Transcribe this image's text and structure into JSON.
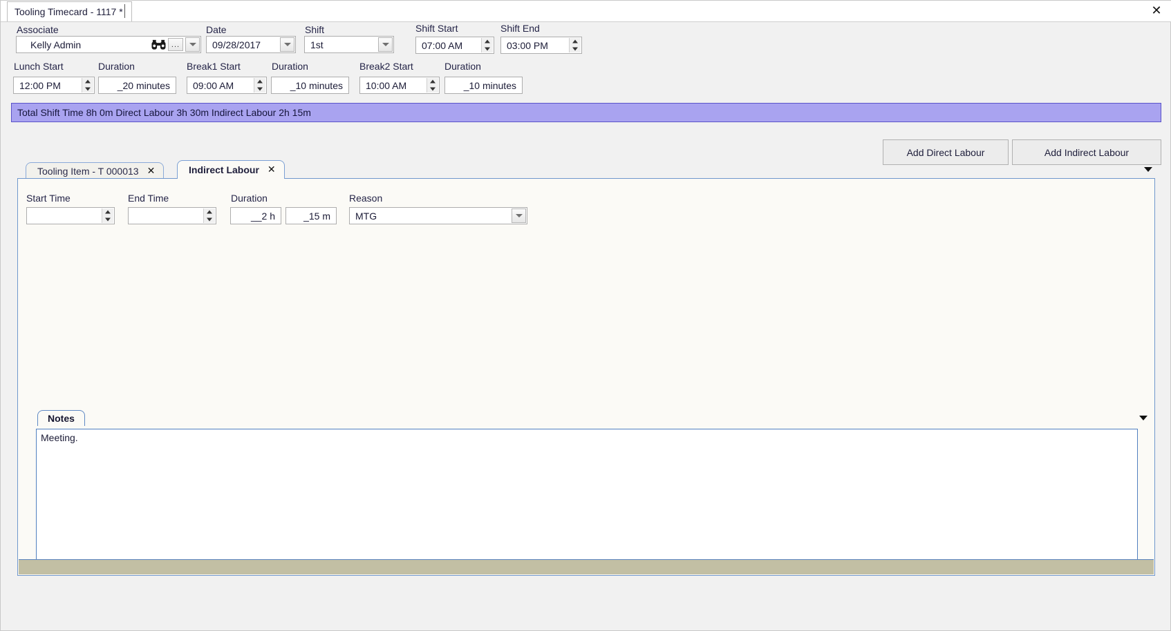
{
  "window": {
    "tab_title": "Tooling Timecard - 1117 *",
    "close_icon": "close-icon"
  },
  "header_form": {
    "associate": {
      "label": "Associate",
      "value": "Kelly Admin",
      "search_icon": "binoculars-icon",
      "browse_label": "...",
      "dropdown_icon": "chevron-down-icon"
    },
    "date": {
      "label": "Date",
      "value": "09/28/2017",
      "dropdown_icon": "chevron-down-icon"
    },
    "shift": {
      "label": "Shift",
      "value": "1st",
      "dropdown_icon": "chevron-down-icon"
    },
    "shift_start": {
      "label": "Shift Start",
      "value": "07:00 AM"
    },
    "shift_end": {
      "label": "Shift End",
      "value": "03:00 PM"
    },
    "lunch_start": {
      "label": "Lunch Start",
      "value": "12:00 PM"
    },
    "lunch_duration": {
      "label": "Duration",
      "value": "_20 minutes"
    },
    "break1_start": {
      "label": "Break1 Start",
      "value": "09:00 AM"
    },
    "break1_duration": {
      "label": "Duration",
      "value": "_10 minutes"
    },
    "break2_start": {
      "label": "Break2 Start",
      "value": "10:00 AM"
    },
    "break2_duration": {
      "label": "Duration",
      "value": "_10 minutes"
    }
  },
  "summary": {
    "text": "Total Shift Time 8h 0m  Direct Labour 3h 30m  Indirect Labour 2h 15m",
    "background_color": "#a9a3f0"
  },
  "actions": {
    "add_direct_labour": "Add Direct Labour",
    "add_indirect_labour": "Add Indirect Labour"
  },
  "tabs": {
    "items": [
      {
        "label": "Tooling Item - T 000013",
        "close_icon": "close-icon",
        "active": false
      },
      {
        "label": "Indirect Labour",
        "close_icon": "close-icon",
        "active": true
      }
    ],
    "overflow_icon": "chevron-down-icon"
  },
  "indirect_labour_form": {
    "start_time": {
      "label": "Start Time",
      "value": ""
    },
    "end_time": {
      "label": "End Time",
      "value": ""
    },
    "duration": {
      "label": "Duration",
      "hours": "__2 h",
      "minutes": "_15 m"
    },
    "reason": {
      "label": "Reason",
      "value": "MTG",
      "dropdown_icon": "chevron-down-icon"
    }
  },
  "notes": {
    "tab_label": "Notes",
    "value": "Meeting.",
    "overflow_icon": "chevron-down-icon"
  }
}
